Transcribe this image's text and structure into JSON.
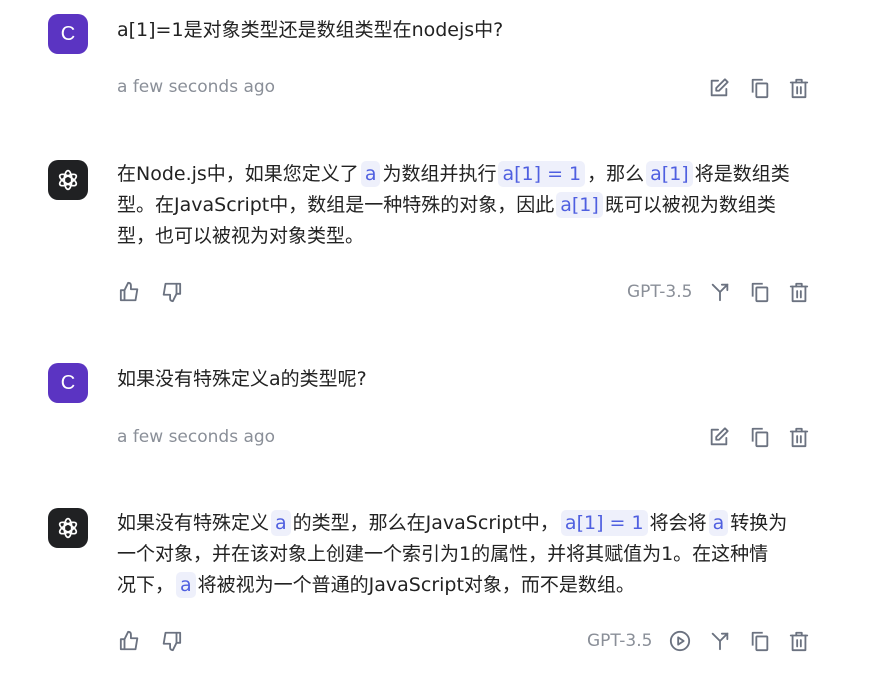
{
  "colors": {
    "accent": "#5b34c2",
    "code_bg": "#eef0fb",
    "code_text": "#4f5fe0",
    "muted": "#8a8f98"
  },
  "messages": [
    {
      "role": "user",
      "avatar_letter": "C",
      "text": "a[1]=1是对象类型还是数组类型在nodejs中?",
      "time": "a few seconds ago"
    },
    {
      "role": "assistant",
      "line1_a": "在Node.js中，如果您定义了",
      "code_a": "a",
      "line1_b": "为数组并执行",
      "code_b": "a[1] = 1",
      "line1_c": "，那么",
      "code_c": "a[1]",
      "line1_d": "将是数组类",
      "line2_a": "型。在JavaScript中，数组是一种特殊的对象，因此",
      "code_d": "a[1]",
      "line2_b": "既可以被视为数组类",
      "line3": "型，也可以被视为对象类型。",
      "model": "GPT-3.5"
    },
    {
      "role": "user",
      "avatar_letter": "C",
      "text": "如果没有特殊定义a的类型呢?",
      "time": "a few seconds ago"
    },
    {
      "role": "assistant",
      "line1_a": "如果没有特殊定义",
      "code_a": "a",
      "line1_b": "的类型，那么在JavaScript中，",
      "code_b": "a[1] = 1",
      "line1_c": "将会将",
      "code_c": "a",
      "line1_d": "转换为",
      "line2": "一个对象，并在该对象上创建一个索引为1的属性，并将其赋值为1。在这种情",
      "line3_a": "况下，",
      "code_d": "a",
      "line3_b": "将被视为一个普通的JavaScript对象，而不是数组。",
      "model": "GPT-3.5"
    }
  ]
}
